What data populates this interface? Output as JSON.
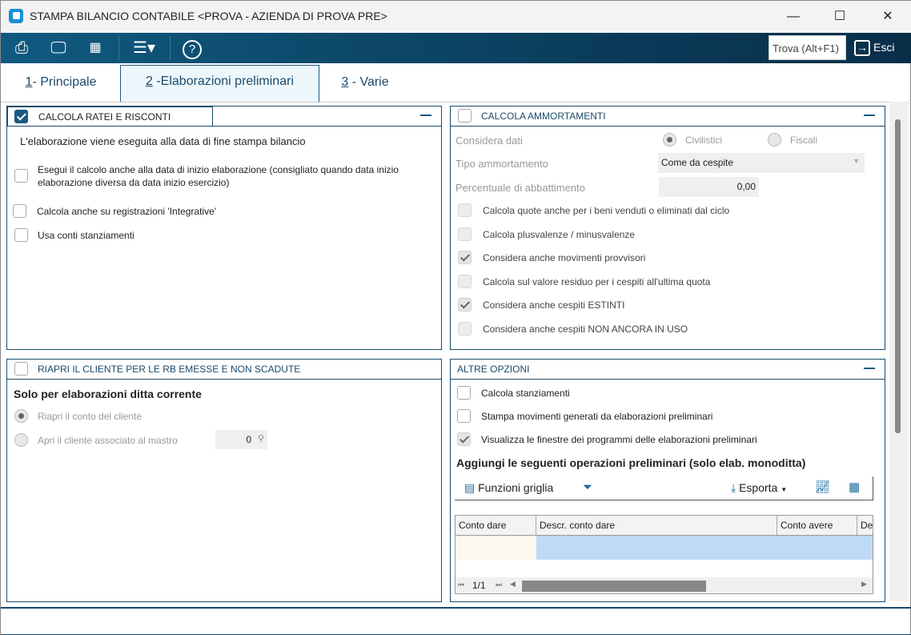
{
  "window": {
    "title": "STAMPA BILANCIO CONTABILE <PROVA - AZIENDA DI PROVA PRE>",
    "minimize": "—",
    "maximize": "☐",
    "close": "✕"
  },
  "toolbar": {
    "search_placeholder": "Trova (Alt+F1)",
    "exit_label": "Esci"
  },
  "tabs": [
    {
      "key": "1",
      "label": "- Principale"
    },
    {
      "key": "2",
      "label": " -Elaborazioni preliminari"
    },
    {
      "key": "3",
      "label": " - Varie"
    }
  ],
  "ratei": {
    "title": "CALCOLA RATEI E RISCONTI",
    "checked": true,
    "info": "L'elaborazione viene eseguita alla data di fine stampa bilancio",
    "opt1_line1": "Esegui il calcolo anche alla data di inizio elaborazione (consigliato quando data inizio",
    "opt1_line2": "elaborazione diversa da data inizio esercizio)",
    "opt2": "Calcola anche su registrazioni 'Integrative'",
    "opt3": "Usa conti stanziamenti"
  },
  "ammortamenti": {
    "title": "CALCOLA AMMORTAMENTI",
    "considera_label": "Considera dati",
    "civilistici": "Civilistici",
    "fiscali": "Fiscali",
    "tipo_label": "Tipo ammortamento",
    "tipo_value": "Come da cespite",
    "perc_label": "Percentuale di abbattimento",
    "perc_value": "0,00",
    "options": [
      {
        "label": "Calcola quote anche per i beni venduti o eliminati dal ciclo",
        "checked": false
      },
      {
        "label": "Calcola plusvalenze / minusvalenze",
        "checked": false
      },
      {
        "label": "Considera anche movimenti provvisori",
        "checked": true
      },
      {
        "label": "Calcola sul valore residuo per i cespiti all'ultima quota",
        "checked": false
      },
      {
        "label": "Considera anche cespiti ESTINTI",
        "checked": true
      },
      {
        "label": "Considera anche cespiti NON ANCORA IN USO",
        "checked": false
      }
    ]
  },
  "riapri": {
    "title": "RIAPRI IL CLIENTE PER LE RB EMESSE E NON SCADUTE",
    "subtitle": "Solo per elaborazioni ditta corrente",
    "opt1": "Riapri il conto del cliente",
    "opt2": "Apri il cliente associato al mastro",
    "mastro_value": "0"
  },
  "altre": {
    "title": "ALTRE OPZIONI",
    "opt1": "Calcola stanziamenti",
    "opt2": "Stampa movimenti generati da elaborazioni preliminari",
    "opt3": "Visualizza le finestre dei programmi delle elaborazioni preliminari",
    "grid_title": "Aggiungi le seguenti operazioni preliminari (solo elab. monoditta)",
    "grid_functions": "Funzioni griglia",
    "export": "Esporta",
    "columns": [
      "Conto dare",
      "Descr. conto dare",
      "Conto avere",
      "De"
    ],
    "pager": "1/1"
  }
}
